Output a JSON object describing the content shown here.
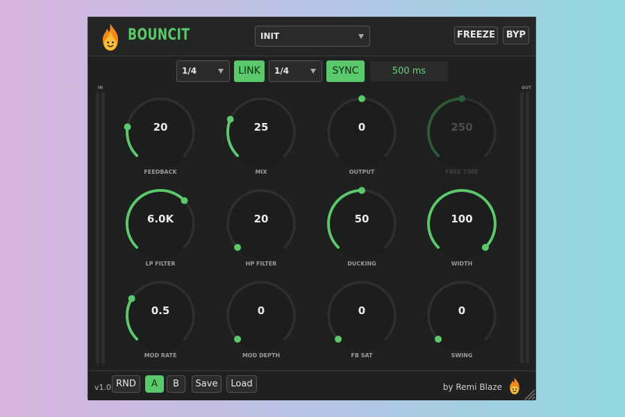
{
  "header": {
    "logo_icon": "flame-face-icon",
    "app_title": "BOUNCIT",
    "preset": {
      "value": "INIT"
    },
    "freeze_label": "FREEZE",
    "bypass_label": "BYP"
  },
  "toolbar": {
    "left_division": "1/4",
    "link_label": "LINK",
    "right_division": "1/4",
    "sync_label": "SYNC",
    "time_display": "500 ms"
  },
  "meters": {
    "in_label": "IN",
    "out_label": "OUT"
  },
  "knobs": [
    {
      "id": "feedback",
      "label": "FEEDBACK",
      "value": "20",
      "level": 0.2,
      "enabled": true
    },
    {
      "id": "mix",
      "label": "MIX",
      "value": "25",
      "level": 0.25,
      "enabled": true
    },
    {
      "id": "output",
      "label": "OUTPUT",
      "value": "0",
      "level": 0.5,
      "bipolar": true,
      "enabled": true
    },
    {
      "id": "free-time",
      "label": "FREE TIME",
      "value": "250",
      "level": 0.5,
      "enabled": false
    },
    {
      "id": "lp-filter",
      "label": "LP FILTER",
      "value": "6.0K",
      "level": 0.67,
      "enabled": true
    },
    {
      "id": "hp-filter",
      "label": "HP FILTER",
      "value": "20",
      "level": 0.0,
      "enabled": true
    },
    {
      "id": "ducking",
      "label": "DUCKING",
      "value": "50",
      "level": 0.5,
      "enabled": true
    },
    {
      "id": "width",
      "label": "WIDTH",
      "value": "100",
      "level": 1.0,
      "enabled": true
    },
    {
      "id": "mod-rate",
      "label": "MOD RATE",
      "value": "0.5",
      "level": 0.28,
      "enabled": true
    },
    {
      "id": "mod-depth",
      "label": "MOD DEPTH",
      "value": "0",
      "level": 0.0,
      "enabled": true
    },
    {
      "id": "fb-sat",
      "label": "FB SAT",
      "value": "0",
      "level": 0.0,
      "enabled": true
    },
    {
      "id": "swing",
      "label": "SWING",
      "value": "0",
      "level": 0.0,
      "enabled": true
    }
  ],
  "footer": {
    "version": "v1.0.",
    "rnd_label": "RND",
    "a_label": "A",
    "b_label": "B",
    "save_label": "Save",
    "load_label": "Load",
    "credit": "by Remi Blaze",
    "logo_icon": "flame-face-icon"
  },
  "colors": {
    "accent": "#5bc86a",
    "panel": "#1f2020",
    "track": "#2d2e2e",
    "disabled_arc": "#2f5a37"
  }
}
